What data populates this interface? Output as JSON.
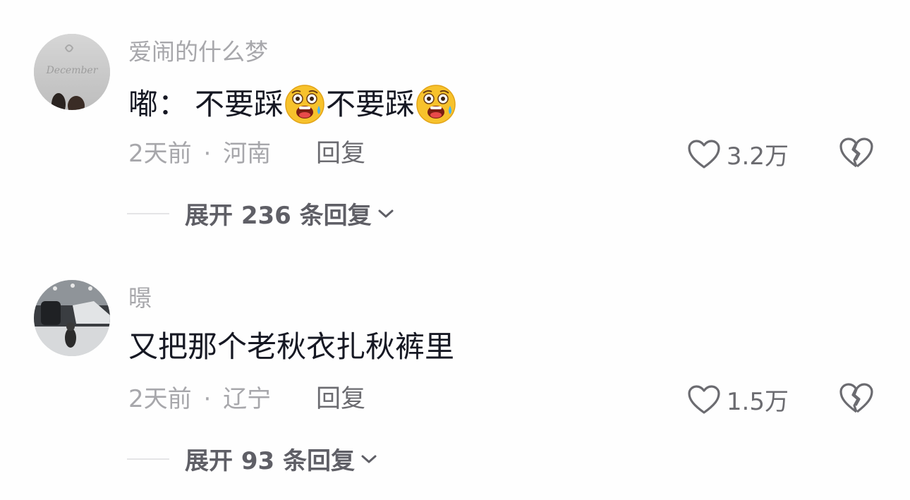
{
  "comments": [
    {
      "username": "爱闹的什么梦",
      "avatar_icon": "avatar-december-paper",
      "content_prefix": "嘟：",
      "content_parts": [
        "不要踩",
        "不要踩"
      ],
      "emoji_icon": "crying-shocked-emoji",
      "time": "2天前",
      "separator": "·",
      "location": "河南",
      "reply_label": "回复",
      "like_count": "3.2万",
      "expand_label": "展开 236 条回复"
    },
    {
      "username": "暻",
      "avatar_icon": "avatar-photo",
      "content": "又把那个老秋衣扎秋裤里",
      "time": "2天前",
      "separator": "·",
      "location": "辽宁",
      "reply_label": "回复",
      "like_count": "1.5万",
      "expand_label": "展开 93 条回复"
    }
  ],
  "colors": {
    "username": "#a7a7ab",
    "content": "#161823",
    "meta": "#a7a7ab",
    "action": "#6b6b70",
    "expand": "#5f5f66"
  }
}
